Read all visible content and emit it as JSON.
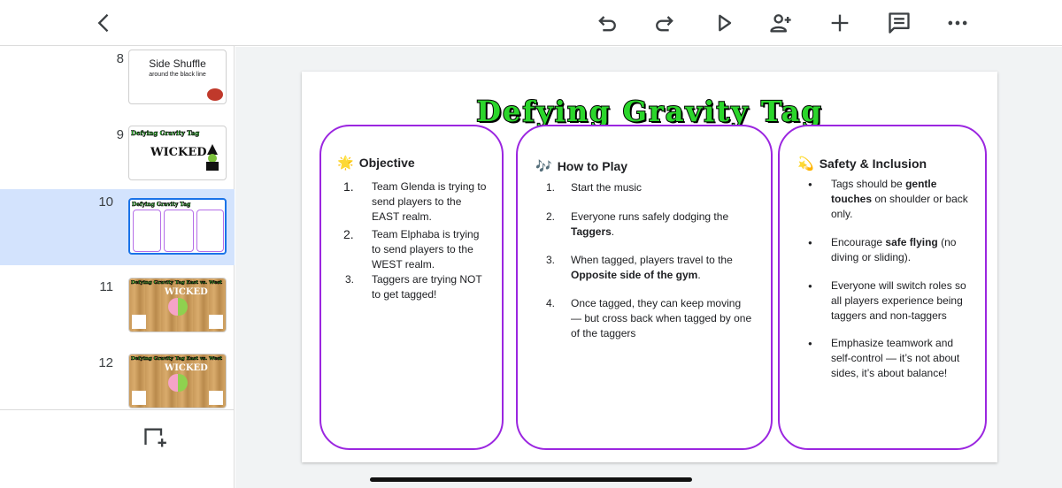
{
  "toolbar": {
    "back": "back-icon",
    "undo": "undo-icon",
    "redo": "redo-icon",
    "present": "play-icon",
    "share": "add-person-icon",
    "insert": "plus-icon",
    "comments": "comment-icon",
    "more": "more-icon"
  },
  "filmstrip": {
    "slides": [
      {
        "number": "8",
        "thumb_title": "Side Shuffle",
        "thumb_subtitle": "around the black line"
      },
      {
        "number": "9",
        "thumb_title": "Defying Gravity Tag",
        "thumb_subtitle": "WICKED"
      },
      {
        "number": "10",
        "thumb_title": "Defying Gravity Tag",
        "selected": true
      },
      {
        "number": "11",
        "thumb_title": "Defying Gravity Tag East vs. West",
        "thumb_subtitle": "WICKED"
      },
      {
        "number": "12",
        "thumb_title": "Defying Gravity Tag East vs. West",
        "thumb_subtitle": "WICKED"
      }
    ],
    "add_slide": "add-slide-icon"
  },
  "slide": {
    "title": "Defying Gravity Tag",
    "panels": {
      "objective": {
        "emoji": "🌟",
        "heading": "Objective",
        "items": [
          {
            "marker": "1.",
            "line1": "Team Glenda is trying to",
            "line2": "send players to the",
            "line3": "EAST realm."
          },
          {
            "marker": "2.",
            "line1": "Team Elphaba is trying",
            "line2": "to send players to the",
            "line3": "WEST realm."
          },
          {
            "marker": "3.",
            "line1": "Taggers are trying NOT",
            "line2": "to get tagged!"
          }
        ]
      },
      "how_to_play": {
        "emoji": "🎶",
        "heading": "How to Play",
        "items": [
          {
            "marker": "1.",
            "line1": "Start the music"
          },
          {
            "marker": "2.",
            "line1": "Everyone runs safely dodging the",
            "line2_bold": "Taggers",
            "line2_rest": "."
          },
          {
            "marker": "3.",
            "line1": "When tagged, players travel to the",
            "line2_bold": "Opposite side of the gym",
            "line2_rest": "."
          },
          {
            "marker": "4.",
            "line1": "Once tagged, they can keep moving",
            "line2": "— but cross back when tagged by one",
            "line3": "of the taggers"
          }
        ]
      },
      "safety": {
        "emoji": "💫",
        "heading": "Safety & Inclusion",
        "items": [
          {
            "marker": "●",
            "line1_pre": "Tags should be ",
            "line1_bold": "gentle",
            "line2_bold": "touches",
            "line2_rest": " on shoulder or back",
            "line3": "only."
          },
          {
            "marker": "●",
            "line1_pre": "Encourage ",
            "line1_bold": "safe flying",
            "line1_rest": " (no",
            "line2": "diving or sliding)."
          },
          {
            "marker": "●",
            "line1": "Everyone will switch roles so",
            "line2": "all players experience being",
            "line3": "taggers and non-taggers"
          },
          {
            "marker": "●",
            "line1": "Emphasize teamwork and",
            "line2": "self-control — it’s not about",
            "line3": "sides, it’s about balance!"
          }
        ]
      }
    }
  }
}
